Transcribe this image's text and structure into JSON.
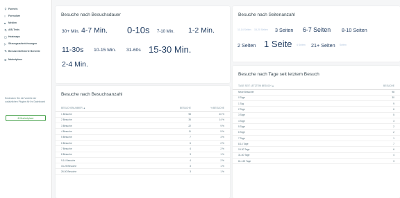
{
  "sidebar": {
    "items": [
      {
        "icon": "funnel-icon",
        "glyph": "⏚",
        "label": "Funnels"
      },
      {
        "icon": "form-icon",
        "glyph": "≡",
        "label": "Formulare"
      },
      {
        "icon": "media-icon",
        "glyph": "■",
        "label": "Medien"
      },
      {
        "icon": "ab-test-icon",
        "glyph": "⚗",
        "label": "A/B-Tests"
      },
      {
        "icon": "heatmap-icon",
        "glyph": "▢",
        "label": "Heatmaps"
      },
      {
        "icon": "session-recording-icon",
        "glyph": "▷",
        "label": "Sitzungsaufzeichnungen"
      },
      {
        "icon": "custom-reports-icon",
        "glyph": "⚗",
        "label": "Benutzerdefinierte Berichte"
      },
      {
        "icon": "plugins-icon",
        "glyph": "⚙",
        "label": "Marketplace"
      }
    ],
    "promo_text": "Entdecken Sie die Vorteile der zusätzlichen Plugins für Ihr Dashboard",
    "promo_button": "⊞ Marketplace"
  },
  "duration_card": {
    "title": "Besuche nach Besuchsdauer",
    "tags": [
      {
        "text": "30+ Min.",
        "size": "s"
      },
      {
        "text": "4-7 Min.",
        "size": "m"
      },
      {
        "text": "0-10s",
        "size": "l"
      },
      {
        "text": "7-10 Min.",
        "size": "xs"
      },
      {
        "text": "1-2 Min.",
        "size": "m"
      },
      {
        "text": "11-30s",
        "size": "m"
      },
      {
        "text": "10-15 Min.",
        "size": "s"
      },
      {
        "text": "31-60s",
        "size": "s"
      },
      {
        "text": "15-30 Min.",
        "size": "l"
      },
      {
        "text": "2-4 Min.",
        "size": "m"
      }
    ]
  },
  "pages_card": {
    "title": "Besuche nach Seitenanzahl",
    "tags": [
      {
        "text": "11-14 Seiten",
        "size": "xxs",
        "light": true
      },
      {
        "text": "15-20 Seiten",
        "size": "xxs",
        "light": true
      },
      {
        "text": "3 Seiten",
        "size": "s"
      },
      {
        "text": "6-7 Seiten",
        "size": "m"
      },
      {
        "text": "8-10 Seiten",
        "size": "s"
      },
      {
        "text": "2 Seiten",
        "size": "s"
      },
      {
        "text": "1 Seite",
        "size": "l"
      },
      {
        "text": "4 Seiten",
        "size": "xxs",
        "light": true
      },
      {
        "text": "21+ Seiten",
        "size": "s"
      },
      {
        "text": "Seiten",
        "size": "xxs",
        "light": true
      }
    ]
  },
  "visits_card": {
    "title": "Besuche nach Besuchsanzahl",
    "columns": [
      "BESUCHSNUMMER ▲",
      "BESUCHE",
      "% BESUCHE"
    ],
    "rows": [
      [
        "1 Besuche",
        "98",
        "40 %"
      ],
      [
        "2 Besuche",
        "35",
        "14 %"
      ],
      [
        "3 Besuche",
        "22",
        "9 %"
      ],
      [
        "4 Besuche",
        "11",
        "5 %"
      ],
      [
        "5 Besuche",
        "7",
        "3 %"
      ],
      [
        "6 Besuche",
        "6",
        "2 %"
      ],
      [
        "7 Besuche",
        "4",
        "2 %"
      ],
      [
        "8 Besuche",
        "3",
        "1 %"
      ],
      [
        "9-14 Besuche",
        "4",
        "2 %"
      ],
      [
        "15-25 Besuche",
        "3",
        "1 %"
      ],
      [
        "26-50 Besuche",
        "3",
        "1 %"
      ]
    ]
  },
  "days_card": {
    "title": "Besuche nach Tage seit letztem Besuch",
    "columns": [
      "TAGE SEIT LETZTEM BESUCH ▲",
      "BESUCHE"
    ],
    "rows": [
      [
        "Neue Besucher",
        "98"
      ],
      [
        "0 Tage",
        "30"
      ],
      [
        "1 Tag",
        "9"
      ],
      [
        "2 Tage",
        "6"
      ],
      [
        "3 Tage",
        "5"
      ],
      [
        "4 Tage",
        "3"
      ],
      [
        "5 Tage",
        "2"
      ],
      [
        "6 Tage",
        "2"
      ],
      [
        "7 Tage",
        "1"
      ],
      [
        "8-14 Tage",
        "7"
      ],
      [
        "15-30 Tage",
        "6"
      ],
      [
        "31-60 Tage",
        "4"
      ],
      [
        "61-120 Tage",
        "3"
      ]
    ]
  }
}
